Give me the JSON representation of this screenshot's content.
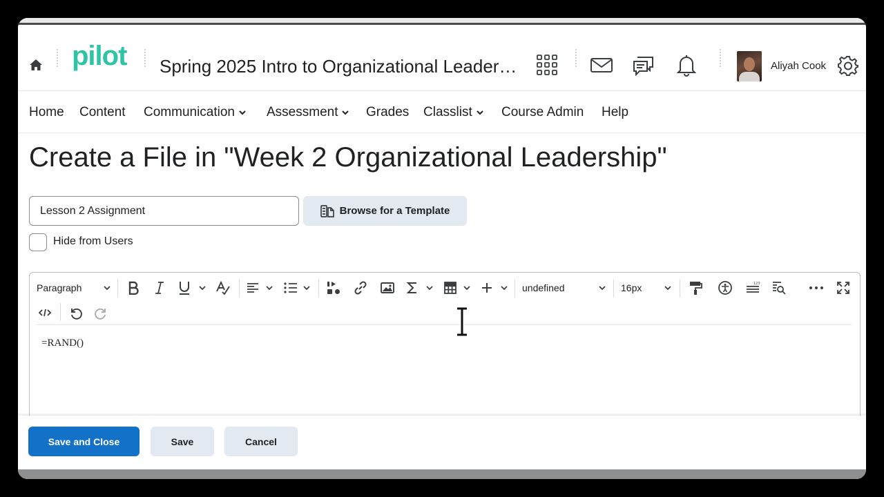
{
  "header": {
    "logo_text": "pilot",
    "course_title": "Spring 2025 Intro to Organizational Leader…",
    "user_name": "Aliyah Cook"
  },
  "nav": {
    "items": [
      {
        "label": "Home"
      },
      {
        "label": "Content"
      },
      {
        "label": "Communication"
      },
      {
        "label": "Assessment"
      },
      {
        "label": "Grades"
      },
      {
        "label": "Classlist"
      },
      {
        "label": "Course Admin"
      },
      {
        "label": "Help"
      }
    ]
  },
  "page": {
    "title": "Create a File in \"Week 2 Organizational Leadership\""
  },
  "form": {
    "title_value": "Lesson 2 Assignment",
    "browse_label": "Browse for a Template",
    "hide_label": "Hide from Users",
    "hide_checked": false
  },
  "editor": {
    "format_select": "Paragraph",
    "font_select": "undefined",
    "size_select": "16px",
    "content": "=RAND()"
  },
  "footer": {
    "save_close_label": "Save and Close",
    "save_label": "Save",
    "cancel_label": "Cancel"
  },
  "colors": {
    "logo": "#2fc4a6",
    "primary_button": "#1471c8",
    "secondary_button": "#e3e9f1"
  }
}
